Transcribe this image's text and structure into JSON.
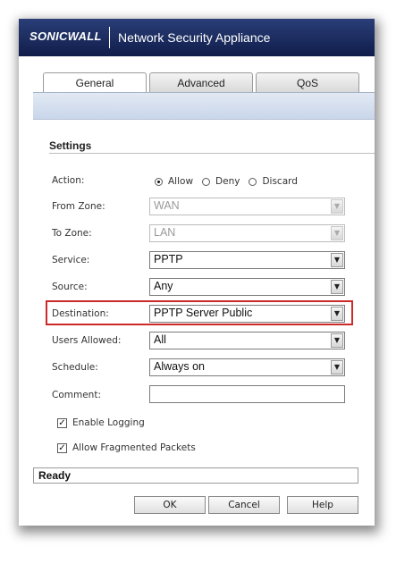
{
  "header": {
    "logo": "SONICWALL",
    "title": "Network Security Appliance"
  },
  "tabs": [
    {
      "label": "General",
      "active": true
    },
    {
      "label": "Advanced",
      "active": false
    },
    {
      "label": "QoS",
      "active": false
    }
  ],
  "settings": {
    "section_title": "Settings",
    "action": {
      "label": "Action:",
      "options": [
        "Allow",
        "Deny",
        "Discard"
      ],
      "selected": "Allow"
    },
    "from_zone": {
      "label": "From Zone:",
      "value": "WAN",
      "disabled": true
    },
    "to_zone": {
      "label": "To Zone:",
      "value": "LAN",
      "disabled": true
    },
    "service": {
      "label": "Service:",
      "value": "PPTP"
    },
    "source": {
      "label": "Source:",
      "value": "Any"
    },
    "destination": {
      "label": "Destination:",
      "value": "PPTP Server Public"
    },
    "users_allowed": {
      "label": "Users Allowed:",
      "value": "All"
    },
    "schedule": {
      "label": "Schedule:",
      "value": "Always on"
    },
    "comment": {
      "label": "Comment:",
      "value": ""
    },
    "enable_logging": {
      "label": "Enable Logging",
      "checked": true
    },
    "allow_fragmented": {
      "label": "Allow Fragmented Packets",
      "checked": true
    }
  },
  "status": "Ready",
  "buttons": {
    "ok": "OK",
    "cancel": "Cancel",
    "help": "Help"
  },
  "colors": {
    "header_bg": "#1c2b5e",
    "highlight_border": "#cc2a2a"
  },
  "icons": {
    "dropdown": "chevron-down-icon",
    "checkbox_mark": "checkmark-icon"
  }
}
